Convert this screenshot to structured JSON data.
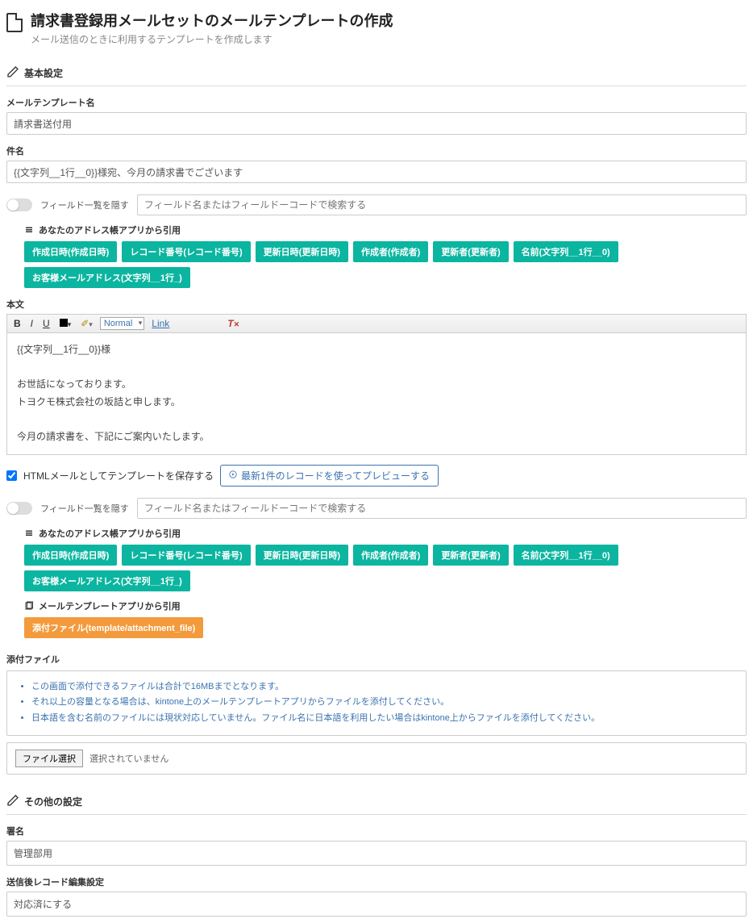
{
  "header": {
    "title": "請求書登録用メールセットのメールテンプレートの作成",
    "subtitle": "メール送信のときに利用するテンプレートを作成します"
  },
  "sections": {
    "basic": "基本設定",
    "other": "その他の設定"
  },
  "labels": {
    "template_name": "メールテンプレート名",
    "subject": "件名",
    "hide_fields": "フィールド一覧を隠す",
    "body": "本文",
    "quote_address_app": "あなたのアドレス帳アプリから引用",
    "quote_template_app": "メールテンプレートアプリから引用",
    "save_as_html": "HTMLメールとしてテンプレートを保存する",
    "preview_button": "最新1件のレコードを使ってプレビューする",
    "attachment": "添付ファイル",
    "file_select": "ファイル選択",
    "file_none": "選択されていません",
    "signature": "署名",
    "post_send": "送信後レコード編集設定",
    "editor_normal": "Normal",
    "editor_link": "Link"
  },
  "values": {
    "template_name": "請求書送付用",
    "subject": "{{文字列__1行__0}}様宛、今月の請求書でございます",
    "body_html": "{{文字列__1行__0}}様<br><br>お世話になっております。<br>トヨクモ株式会社の坂詰と申します。<br><br>今月の請求書を、下記にご案内いたします。",
    "signature": "管理部用",
    "post_send": "対応済にする"
  },
  "placeholders": {
    "field_search": "フィールド名またはフィールドーコードで検索する"
  },
  "tags_address": [
    "作成日時(作成日時)",
    "レコード番号(レコード番号)",
    "更新日時(更新日時)",
    "作成者(作成者)",
    "更新者(更新者)",
    "名前(文字列__1行__0)",
    "お客様メールアドレス(文字列__1行_)"
  ],
  "tags_template": [
    "添付ファイル(template/attachment_file)"
  ],
  "attach_notes": [
    "この画面で添付できるファイルは合計で16MBまでとなります。",
    "それ以上の容量となる場合は、kintone上のメールテンプレートアプリからファイルを添付してください。",
    "日本語を含む名前のファイルには現状対応していません。ファイル名に日本語を利用したい場合はkintone上からファイルを添付してください。"
  ]
}
